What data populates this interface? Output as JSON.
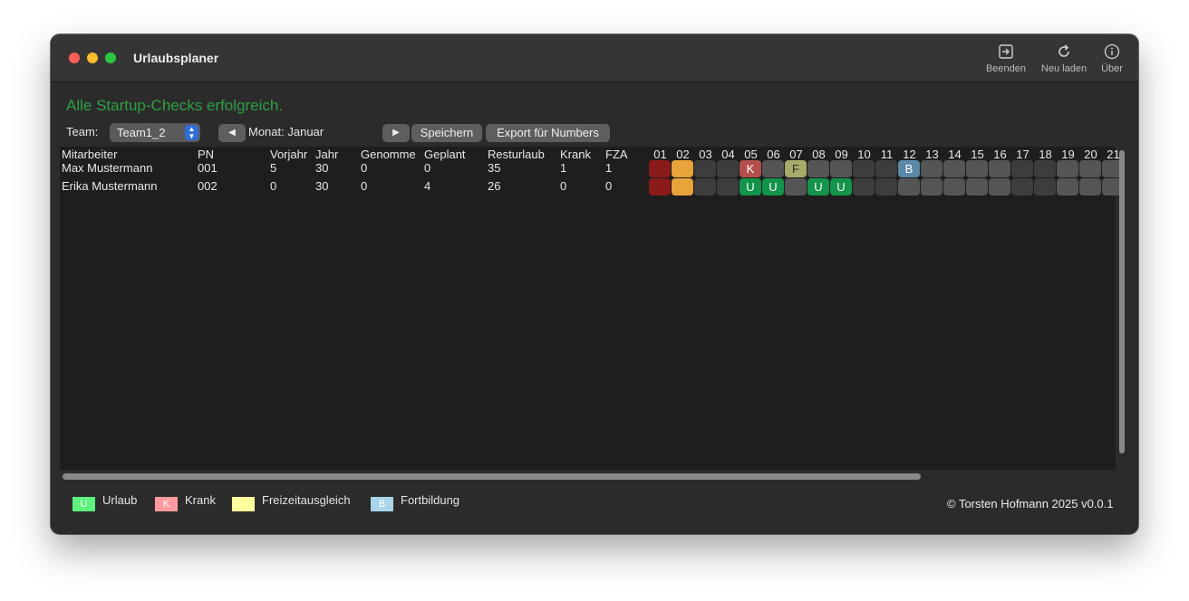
{
  "window": {
    "title": "Urlaubsplaner"
  },
  "toolbar": {
    "quit_label": "Beenden",
    "reload_label": "Neu laden",
    "about_label": "Über"
  },
  "status_message": "Alle Startup-Checks erfolgreich.",
  "controls": {
    "team_label": "Team:",
    "team_value": "Team1_2",
    "prev_symbol": "◀",
    "month_label": "Monat: Januar",
    "next_symbol": "▶",
    "save_label": "Speichern",
    "export_label": "Export für Numbers"
  },
  "table": {
    "columns": [
      "Mitarbeiter",
      "PN",
      "Vorjahr",
      "Jahr",
      "Genomme",
      "Geplant",
      "Resturlaub",
      "Krank",
      "FZA"
    ],
    "days": [
      "01",
      "02",
      "03",
      "04",
      "05",
      "06",
      "07",
      "08",
      "09",
      "10",
      "11",
      "12",
      "13",
      "14",
      "15",
      "16",
      "17",
      "18",
      "19",
      "20",
      "21"
    ],
    "rows": [
      {
        "cells": [
          "Max Mustermann",
          "001",
          "5",
          "30",
          "0",
          "0",
          "35",
          "1",
          "1"
        ],
        "days": [
          {
            "type": "holiday",
            "code": ""
          },
          {
            "type": "bridge",
            "code": ""
          },
          {
            "type": "weekend",
            "code": ""
          },
          {
            "type": "weekend",
            "code": ""
          },
          {
            "type": "krank",
            "code": "K"
          },
          {
            "type": "workday",
            "code": ""
          },
          {
            "type": "fza",
            "code": "F"
          },
          {
            "type": "workday",
            "code": ""
          },
          {
            "type": "workday",
            "code": ""
          },
          {
            "type": "weekend",
            "code": ""
          },
          {
            "type": "weekend",
            "code": ""
          },
          {
            "type": "fortbildung",
            "code": "B"
          },
          {
            "type": "workday",
            "code": ""
          },
          {
            "type": "workday",
            "code": ""
          },
          {
            "type": "workday",
            "code": ""
          },
          {
            "type": "workday",
            "code": ""
          },
          {
            "type": "weekend",
            "code": ""
          },
          {
            "type": "weekend",
            "code": ""
          },
          {
            "type": "workday",
            "code": ""
          },
          {
            "type": "workday",
            "code": ""
          },
          {
            "type": "workday",
            "code": ""
          }
        ]
      },
      {
        "cells": [
          "Erika Mustermann",
          "002",
          "0",
          "30",
          "0",
          "4",
          "26",
          "0",
          "0"
        ],
        "days": [
          {
            "type": "holiday",
            "code": ""
          },
          {
            "type": "bridge",
            "code": ""
          },
          {
            "type": "weekend",
            "code": ""
          },
          {
            "type": "weekend",
            "code": ""
          },
          {
            "type": "urlaub",
            "code": "U"
          },
          {
            "type": "urlaub",
            "code": "U"
          },
          {
            "type": "workday",
            "code": ""
          },
          {
            "type": "urlaub",
            "code": "U"
          },
          {
            "type": "urlaub",
            "code": "U"
          },
          {
            "type": "weekend",
            "code": ""
          },
          {
            "type": "weekend",
            "code": ""
          },
          {
            "type": "workday",
            "code": ""
          },
          {
            "type": "workday",
            "code": ""
          },
          {
            "type": "workday",
            "code": ""
          },
          {
            "type": "workday",
            "code": ""
          },
          {
            "type": "workday",
            "code": ""
          },
          {
            "type": "weekend",
            "code": ""
          },
          {
            "type": "weekend",
            "code": ""
          },
          {
            "type": "workday",
            "code": ""
          },
          {
            "type": "workday",
            "code": ""
          },
          {
            "type": "workday",
            "code": ""
          }
        ]
      }
    ]
  },
  "cell_colors": {
    "holiday": "#8b1a1a",
    "bridge": "#e8a33a",
    "weekend": "#3d3d3d",
    "workday": "#555555",
    "urlaub": "#14934a",
    "krank": "#b3504e",
    "fza": "#a8ac6a",
    "fortbildung": "#5b8aa8"
  },
  "legend": [
    {
      "code": "U",
      "label": "Urlaub",
      "color": "#5bf27e"
    },
    {
      "code": "K",
      "label": "Krank",
      "color": "#ff9aa0"
    },
    {
      "code": "",
      "label": "Freizeitausgleich",
      "color": "#ffff9e"
    },
    {
      "code": "B",
      "label": "Fortbildung",
      "color": "#a8d5ea"
    }
  ],
  "footer": {
    "copyright": "© Torsten Hofmann 2025 v0.0.1"
  }
}
